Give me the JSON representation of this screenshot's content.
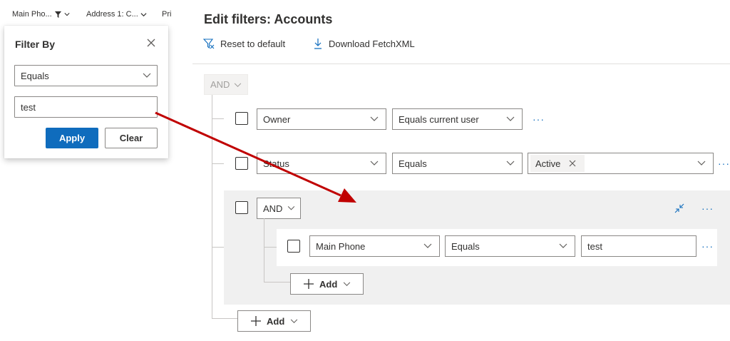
{
  "column_headers": [
    {
      "label": "Main Pho..."
    },
    {
      "label": "Address 1: C..."
    },
    {
      "label": "Pri"
    }
  ],
  "filter_popup": {
    "title": "Filter By",
    "operator_value": "Equals",
    "input_value": "test",
    "apply_label": "Apply",
    "clear_label": "Clear"
  },
  "edit_panel": {
    "title": "Edit filters: Accounts",
    "reset_label": "Reset to default",
    "download_label": "Download FetchXML",
    "root_operator": "AND",
    "rows": [
      {
        "field": "Owner",
        "operator": "Equals current user"
      },
      {
        "field": "Status",
        "operator": "Equals",
        "value_tag": "Active"
      }
    ],
    "group": {
      "operator": "AND",
      "row": {
        "field": "Main Phone",
        "operator": "Equals",
        "value": "test"
      },
      "add_label": "Add"
    },
    "add_label": "Add",
    "more_label": "···"
  },
  "annotation_arrow_color": "#c00000",
  "accent_color": "#0f6cbd"
}
